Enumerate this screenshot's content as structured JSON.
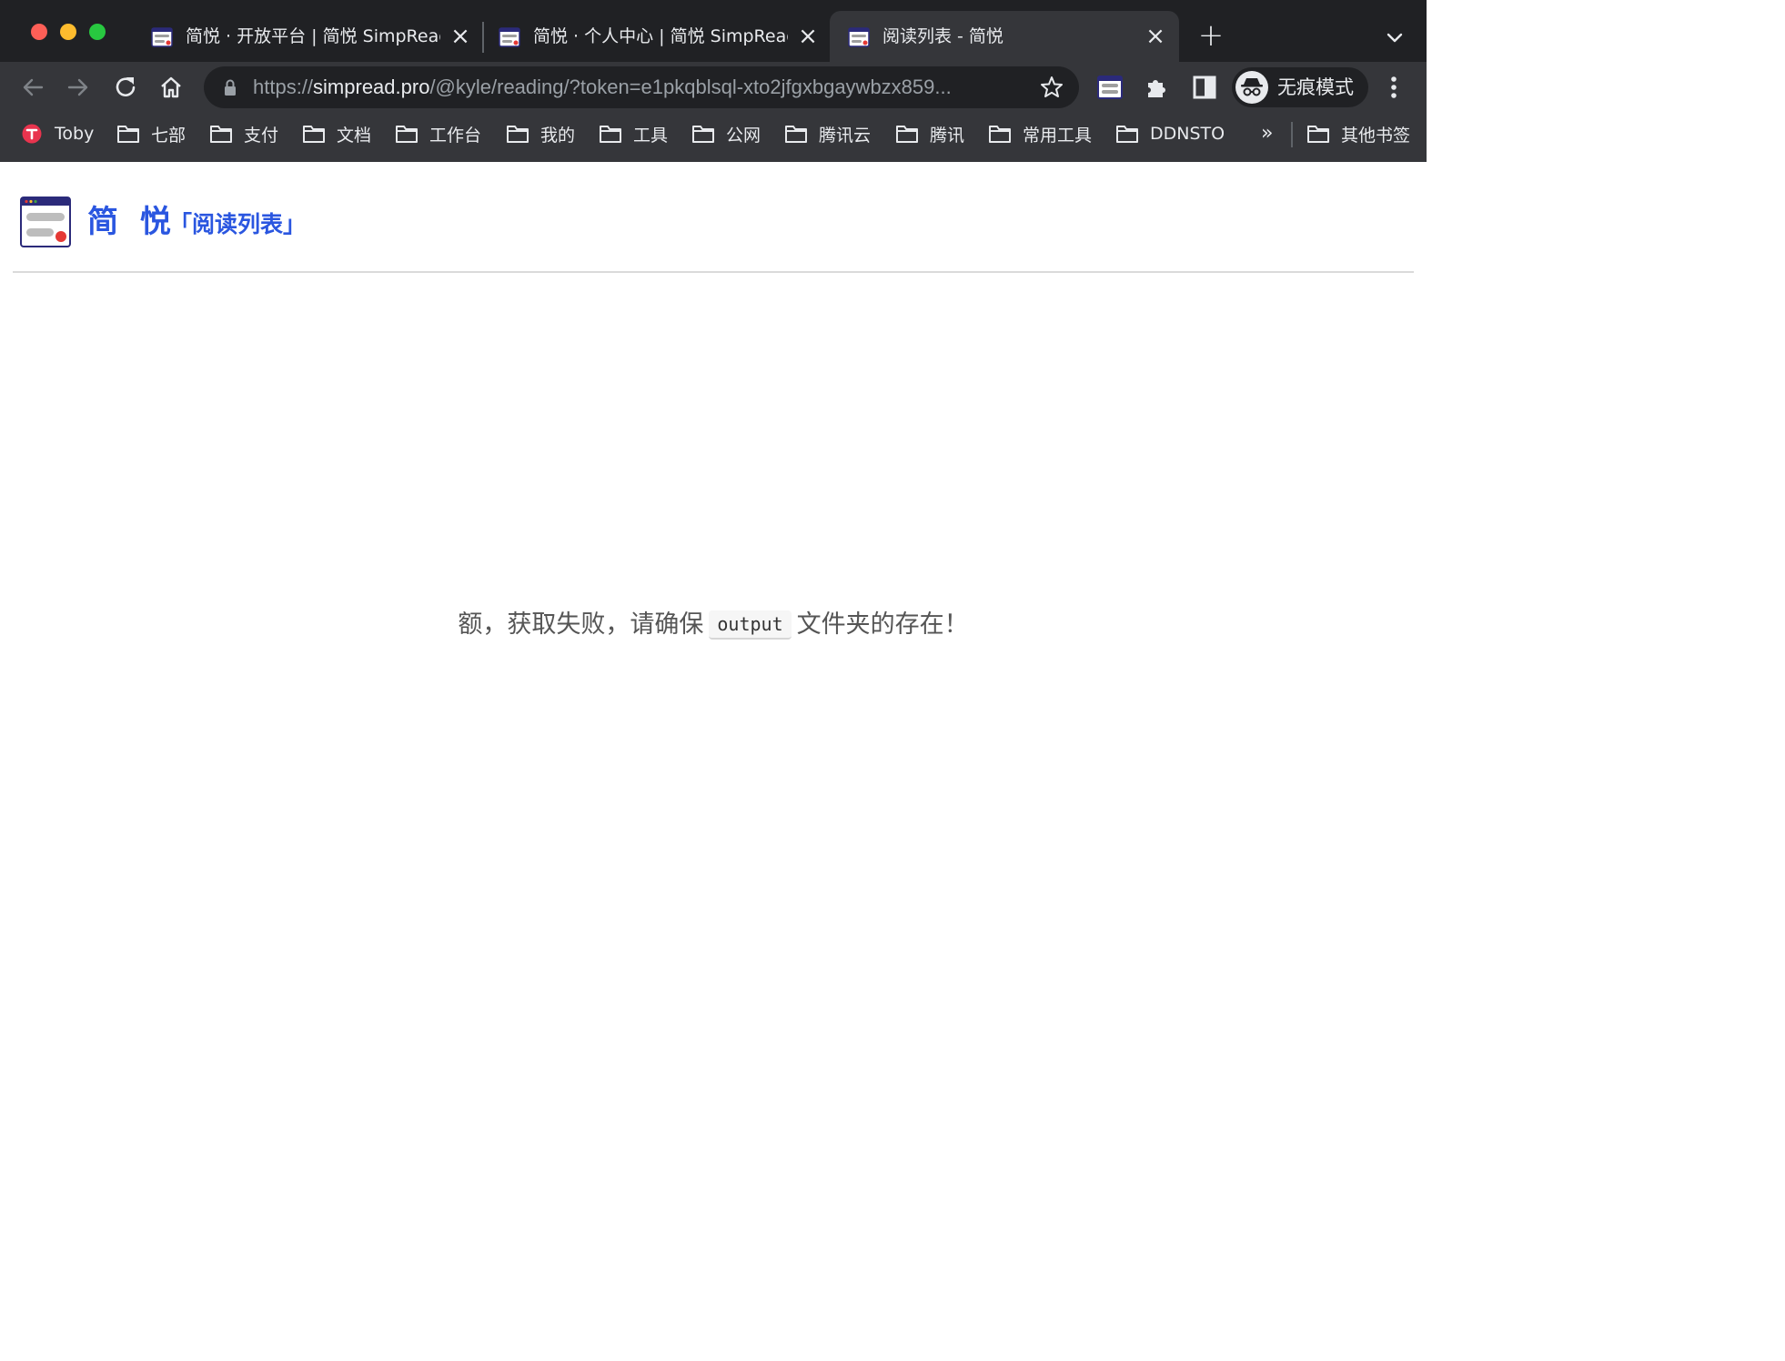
{
  "browser": {
    "tabs": [
      {
        "title": "简悦 · 开放平台 | 简悦 SimpRead",
        "active": false
      },
      {
        "title": "简悦 · 个人中心 | 简悦 SimpRead",
        "active": false
      },
      {
        "title": "阅读列表 - 简悦",
        "active": true
      }
    ],
    "address": {
      "scheme": "https://",
      "host": "simpread.pro",
      "path": "/@kyle/reading/?token=e1pkqblsql-xto2jfgxbgaywbzx859..."
    },
    "profile_label": "无痕模式",
    "bookmarks": [
      {
        "label": "Toby",
        "icon": "toby-icon"
      },
      {
        "label": "七部",
        "icon": "folder-icon"
      },
      {
        "label": "支付",
        "icon": "folder-icon"
      },
      {
        "label": "文档",
        "icon": "folder-icon"
      },
      {
        "label": "工作台",
        "icon": "folder-icon"
      },
      {
        "label": "我的",
        "icon": "folder-icon"
      },
      {
        "label": "工具",
        "icon": "folder-icon"
      },
      {
        "label": "公网",
        "icon": "folder-icon"
      },
      {
        "label": "腾讯云",
        "icon": "folder-icon"
      },
      {
        "label": "腾讯",
        "icon": "folder-icon"
      },
      {
        "label": "常用工具",
        "icon": "folder-icon"
      },
      {
        "label": "DDNSTO",
        "icon": "folder-icon"
      }
    ],
    "bookmarks_overflow": "»",
    "other_bookmarks": "其他书签"
  },
  "page": {
    "brand": "简 悦",
    "subtitle": "「阅读列表」",
    "message_before": "额，获取失败，请确保",
    "message_code": "output",
    "message_after": "文件夹的存在！"
  },
  "colors": {
    "brand": "#2a56e0",
    "chrome_dark": "#202124",
    "chrome_toolbar": "#35363a"
  }
}
